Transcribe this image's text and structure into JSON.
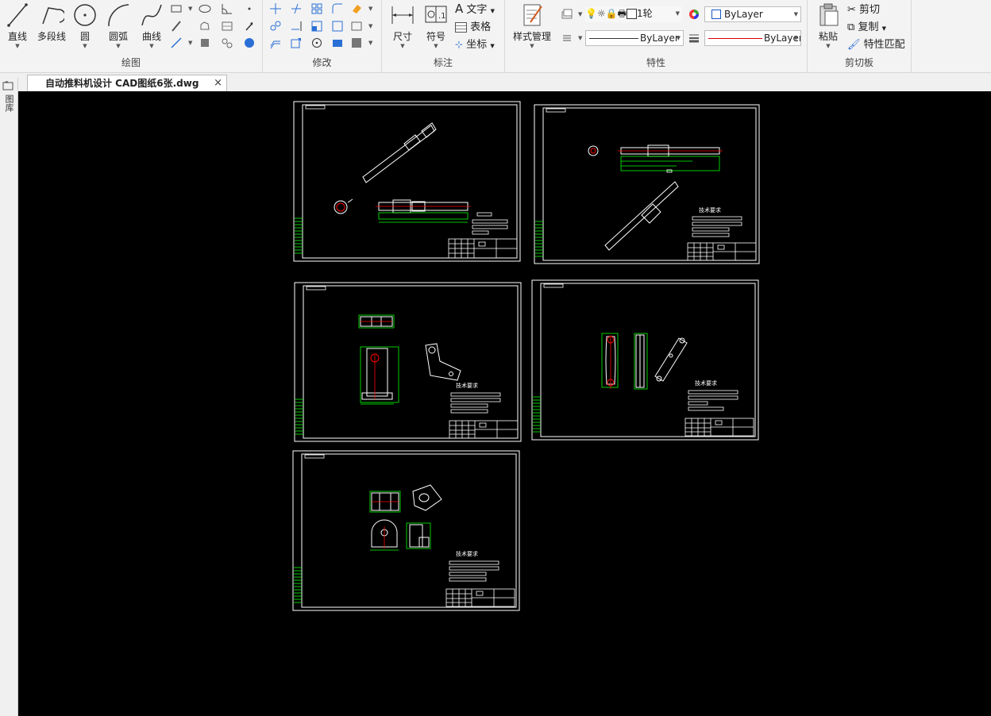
{
  "ribbon": {
    "draw": {
      "panel_label": "绘图",
      "line": "直线",
      "polyline": "多段线",
      "circle": "圆",
      "arc": "圆弧",
      "curve": "曲线"
    },
    "modify": {
      "panel_label": "修改"
    },
    "annotate": {
      "panel_label": "标注",
      "dimension": "尺寸",
      "symbol": "符号",
      "text": "文字",
      "table": "表格",
      "coord": "坐标"
    },
    "properties": {
      "panel_label": "特性",
      "style_manager": "样式管理",
      "layer_value": "1轮",
      "color_value": "ByLayer",
      "linetype_value": "ByLayer",
      "lineweight_value": "ByLayer"
    },
    "clipboard": {
      "panel_label": "剪切板",
      "paste": "粘贴",
      "cut": "剪切",
      "copy": "复制",
      "match": "特性匹配"
    }
  },
  "document_tab": {
    "title": "自动推料机设计 CAD图纸6张.dwg",
    "close": "×"
  },
  "left_toolbar": {
    "label": "图库"
  },
  "drawing": {
    "tech_req": "技术要求",
    "colors": {
      "frame": "#ffffff",
      "dim": "#00ff00",
      "center": "#ff0000",
      "bg": "#000000"
    }
  }
}
